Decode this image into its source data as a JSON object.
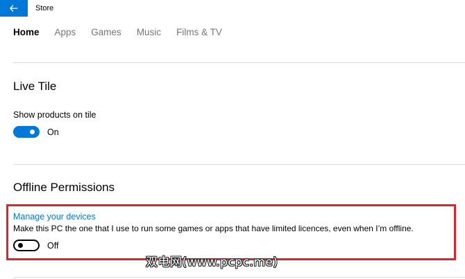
{
  "window": {
    "title": "Store",
    "accent_color": "#0078d7"
  },
  "nav": {
    "tabs": [
      {
        "label": "Home",
        "active": true
      },
      {
        "label": "Apps",
        "active": false
      },
      {
        "label": "Games",
        "active": false
      },
      {
        "label": "Music",
        "active": false
      },
      {
        "label": "Films & TV",
        "active": false
      }
    ]
  },
  "live_tile": {
    "heading": "Live Tile",
    "setting_label": "Show products on tile",
    "toggle_state": "On",
    "toggle_on": true
  },
  "offline": {
    "heading": "Offline Permissions",
    "link": "Manage your devices",
    "description": "Make this PC the one that I use to run some games or apps that have limited licences, even when I’m offline.",
    "toggle_state": "Off",
    "toggle_on": false,
    "highlight_color": "#e2202a"
  },
  "watermark": {
    "text": "双电网(www.pcpc.me)"
  }
}
